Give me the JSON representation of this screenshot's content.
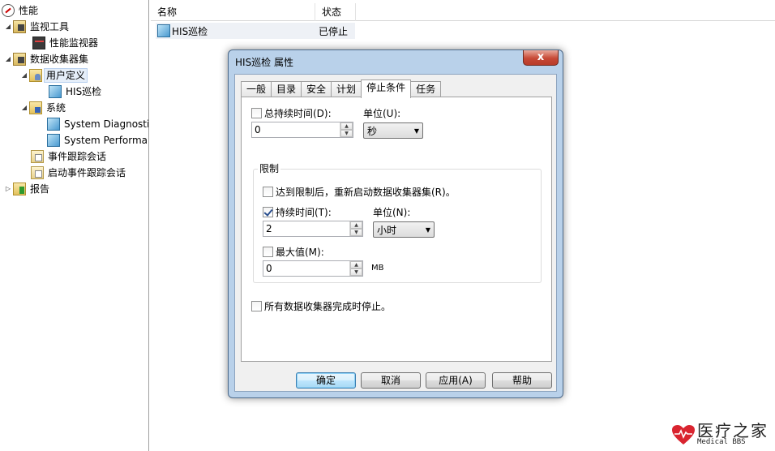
{
  "tree": {
    "items": [
      {
        "label": "性能",
        "icon": "performance-icon",
        "level": 0,
        "expander": ""
      },
      {
        "label": "监视工具",
        "icon": "monitoring-tools-icon",
        "level": 1,
        "expander": "expanded"
      },
      {
        "label": "性能监视器",
        "icon": "performance-monitor-icon",
        "level": 2,
        "expander": ""
      },
      {
        "label": "数据收集器集",
        "icon": "data-collector-sets-icon",
        "level": 1,
        "expander": "expanded"
      },
      {
        "label": "用户定义",
        "icon": "user-defined-folder-icon",
        "level": 2,
        "expander": "expanded",
        "selected": true
      },
      {
        "label": "HIS巡检",
        "icon": "collector-set-icon",
        "level": 3,
        "expander": ""
      },
      {
        "label": "系统",
        "icon": "system-folder-icon",
        "level": 2,
        "expander": "expanded"
      },
      {
        "label": "System Diagnostics",
        "icon": "collector-set-icon",
        "level": 3,
        "expander": ""
      },
      {
        "label": "System Performance",
        "icon": "collector-set-icon",
        "level": 3,
        "expander": ""
      },
      {
        "label": "事件跟踪会话",
        "icon": "event-trace-icon",
        "level": 2,
        "expander": ""
      },
      {
        "label": "启动事件跟踪会话",
        "icon": "startup-event-trace-icon",
        "level": 2,
        "expander": ""
      },
      {
        "label": "报告",
        "icon": "reports-icon",
        "level": 1,
        "expander": "collapsed"
      }
    ]
  },
  "list": {
    "columns": [
      "名称",
      "状态"
    ],
    "rows": [
      {
        "name": "HIS巡检",
        "status": "已停止"
      }
    ]
  },
  "dialog": {
    "title": "HIS巡检 属性",
    "close_label": "x",
    "tabs": [
      "一般",
      "目录",
      "安全",
      "计划",
      "停止条件",
      "任务"
    ],
    "active_tab": "停止条件",
    "overall_duration": {
      "label": "总持续时间(D):",
      "checked": false,
      "value": "0",
      "unit_label": "单位(U):",
      "unit": "秒"
    },
    "limits": {
      "title": "限制",
      "restart_label": "达到限制后，重新启动数据收集器集(R)。",
      "restart_checked": false,
      "duration_label": "持续时间(T):",
      "duration_checked": true,
      "duration_value": "2",
      "duration_unit_label": "单位(N):",
      "duration_unit": "小时",
      "maxsize_label": "最大值(M):",
      "maxsize_checked": false,
      "maxsize_value": "0",
      "maxsize_unit": "MB"
    },
    "stop_when_all_done_label": "所有数据收集器完成时停止。",
    "stop_when_all_done_checked": false,
    "buttons": {
      "ok": "确定",
      "cancel": "取消",
      "apply": "应用(A)",
      "help": "帮助"
    }
  },
  "watermark": {
    "cn": "医疗之家",
    "en": "Medical BBS",
    "color": "#d9242f"
  }
}
